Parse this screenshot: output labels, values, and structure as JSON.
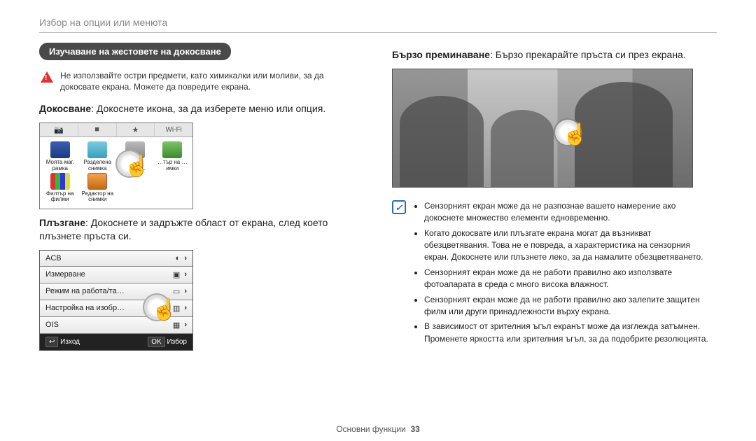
{
  "breadcrumb": "Избор на опции или менюта",
  "left": {
    "section_title": "Изучаване на жестовете на докосване",
    "warning": "Не използвайте остри предмети, като химикалки или моливи, за да докосвате екрана. Можете да повредите екрана.",
    "touch_heading_bold": "Докосване",
    "touch_heading_rest": ": Докоснете икона, за да изберете меню или опция.",
    "tabs": {
      "t1": "📷",
      "t2": "■",
      "t3": "★",
      "t4": "Wi-Fi"
    },
    "apps": {
      "a0": "Моята маг. рамка",
      "a1": "Разделена снимка",
      "a2": "Сним. движе…",
      "a3": "…тър на …имки",
      "a4": "Филтър на филми",
      "a5": "Редактор на снимки"
    },
    "drag_heading_bold": "Плъзгане",
    "drag_heading_rest": ": Докоснете и задръжте област от екрана, след което плъзнете пръста си.",
    "menu": {
      "r0": "ACB",
      "r1": "Измерване",
      "r2": "Режим на работа/та…",
      "r3": "Настройка на изобр…",
      "r4": "OIS",
      "footer_left": "Изход",
      "footer_right": "Избор",
      "ok": "OK",
      "back": "↩"
    }
  },
  "right": {
    "swipe_heading_bold": "Бързо преминаване",
    "swipe_heading_rest": ": Бързо прекарайте пръста си през екрана.",
    "notes": {
      "n0": "Сензорният екран може да не разпознае вашето намерение ако докоснете множество елементи едновременно.",
      "n1": "Когато докосвате или плъзгате екрана могат да възникват обезцветявания. Това не е повреда, а характеристика на сензорния екран. Докоснете или плъзнете леко, за да намалите обезцветяването.",
      "n2": "Сензорният екран може да не работи правилно ако използвате фотоапарата в среда с много висока влажност.",
      "n3": "Сензорният екран може да не работи правилно ако залепите защитен филм или други принадлежности върху екрана.",
      "n4": "В зависимост от зрителния ъгъл екранът може да изглежда затъмнен. Променете яркостта или зрителния ъгъл, за да подобрите резолюцията."
    }
  },
  "footer": {
    "section": "Основни функции",
    "page": "33"
  }
}
